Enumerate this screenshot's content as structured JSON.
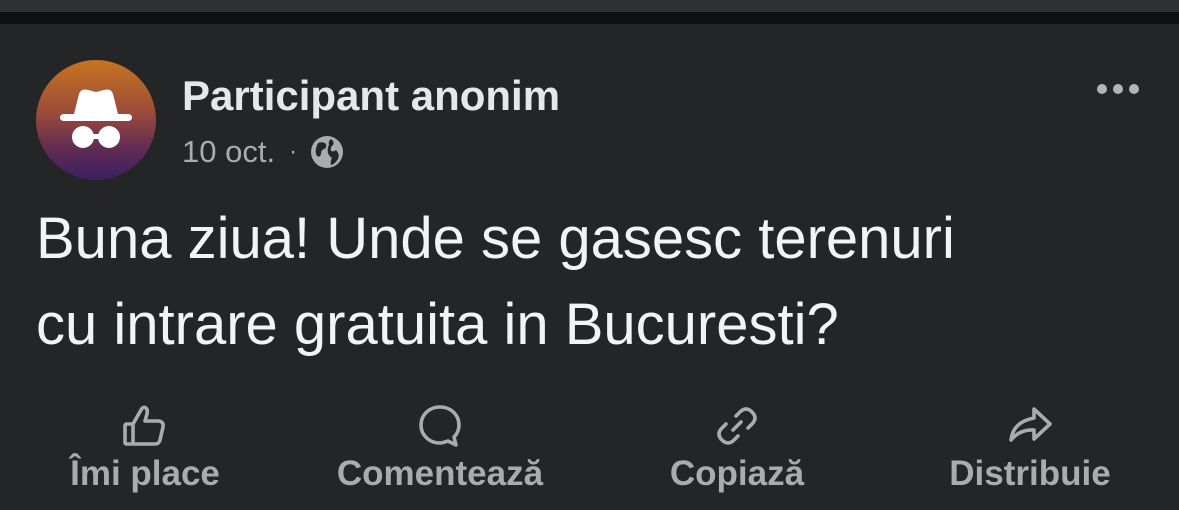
{
  "post": {
    "author": "Participant anonim",
    "date": "10 oct.",
    "separator": "·",
    "audience_icon": "globe-icon",
    "text_lines": [
      "Buna ziua! Unde se gasesc terenuri",
      "cu intrare gratuita in Bucuresti?"
    ]
  },
  "avatar": {
    "icon": "incognito-icon",
    "gradient": [
      "#c7741e",
      "#9a4a3a",
      "#5f2a55",
      "#3a2060"
    ]
  },
  "menu": {
    "icon": "more-horizontal-icon"
  },
  "actions": [
    {
      "label": "Îmi place",
      "icon": "thumbs-up-icon"
    },
    {
      "label": "Comentează",
      "icon": "comment-bubble-icon"
    },
    {
      "label": "Copiază",
      "icon": "link-icon"
    },
    {
      "label": "Distribuie",
      "icon": "share-arrow-icon"
    }
  ],
  "colors": {
    "background": "#242527",
    "primary_text": "#f2f3f4",
    "secondary_text": "#a9abae"
  }
}
